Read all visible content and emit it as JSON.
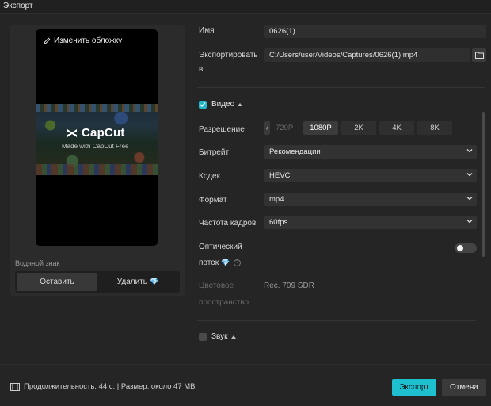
{
  "window": {
    "title": "Экспорт"
  },
  "preview": {
    "change_cover": "Изменить обложку",
    "brand_name": "CapCut",
    "brand_sub": "Made with CapCut Free",
    "watermark_label": "Водяной знак",
    "keep": "Оставить",
    "remove": "Удалить",
    "remove_gem": "💎"
  },
  "settings": {
    "name_label": "Имя",
    "name_value": "0626(1)",
    "export_label_line1": "Экспортировать",
    "export_label_line2": "в",
    "export_path": "C:/Users/user/Videos/Captures/0626(1).mp4",
    "video": {
      "title": "Видео",
      "checked": true,
      "resolution_label": "Разрешение",
      "resolution_options": [
        "720P",
        "1080P",
        "2K",
        "4K",
        "8K"
      ],
      "resolution_selected": "1080P",
      "bitrate_label": "Битрейт",
      "bitrate_value": "Рекомендации",
      "codec_label": "Кодек",
      "codec_value": "HEVC",
      "format_label": "Формат",
      "format_value": "mp4",
      "fps_label": "Частота кадров",
      "fps_value": "60fps",
      "optical_line1": "Оптический",
      "optical_line2": "поток",
      "optical_gem": "💎",
      "optical_enabled": false,
      "colorspace_line1": "Цветовое",
      "colorspace_line2": "пространство",
      "colorspace_value": "Rec. 709 SDR"
    },
    "audio": {
      "title": "Звук",
      "checked": false
    }
  },
  "footer": {
    "info": "Продолжительность: 44 с. | Размер: около 47 MB",
    "export": "Экспорт",
    "cancel": "Отмена"
  },
  "colors": {
    "accent": "#1ec0cf",
    "gem": "#a78bfa"
  }
}
